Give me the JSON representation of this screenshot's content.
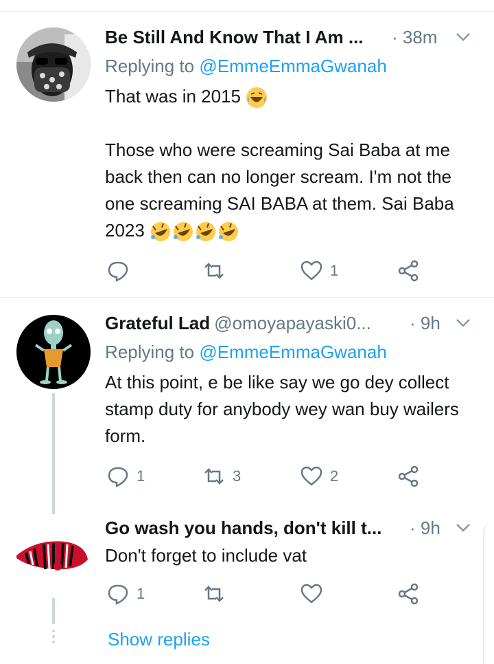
{
  "tweets": [
    {
      "name": "Be Still And Know That I Am ...",
      "handle": "",
      "time": "· 38m",
      "replying_prefix": "Replying to ",
      "replying_to": "@EmmeEmmaGwanah",
      "text_lines": [
        "That was in 2015",
        "Those who were screaming Sai Baba at me back then can no longer scream. I'm not the one screaming SAI BABA at them. Sai Baba 2023"
      ],
      "reply_count": "",
      "retweet_count": "",
      "like_count": "1"
    },
    {
      "name": "Grateful Lad",
      "handle": "@omoyapayaski0...",
      "time": "· 9h",
      "replying_prefix": "Replying to ",
      "replying_to": "@EmmeEmmaGwanah",
      "text_lines": [
        "At this point, e be like say we go dey collect stamp duty for anybody wey wan buy wailers form."
      ],
      "reply_count": "1",
      "retweet_count": "3",
      "like_count": "2"
    },
    {
      "name": "Go wash you hands, don't kill t...",
      "handle": "",
      "time": "· 9h",
      "text_lines": [
        "Don't forget to include vat"
      ],
      "reply_count": "1",
      "retweet_count": "",
      "like_count": ""
    }
  ],
  "show_replies": "Show replies",
  "icons": [
    "reply-icon",
    "retweet-icon",
    "like-icon",
    "share-icon",
    "chevron-down-icon",
    "laughing-emoji",
    "rofl-emoji"
  ],
  "colors": {
    "link": "#1da1f2",
    "secondary": "#657786",
    "text": "#14171a",
    "divider": "#e6ecf0"
  }
}
